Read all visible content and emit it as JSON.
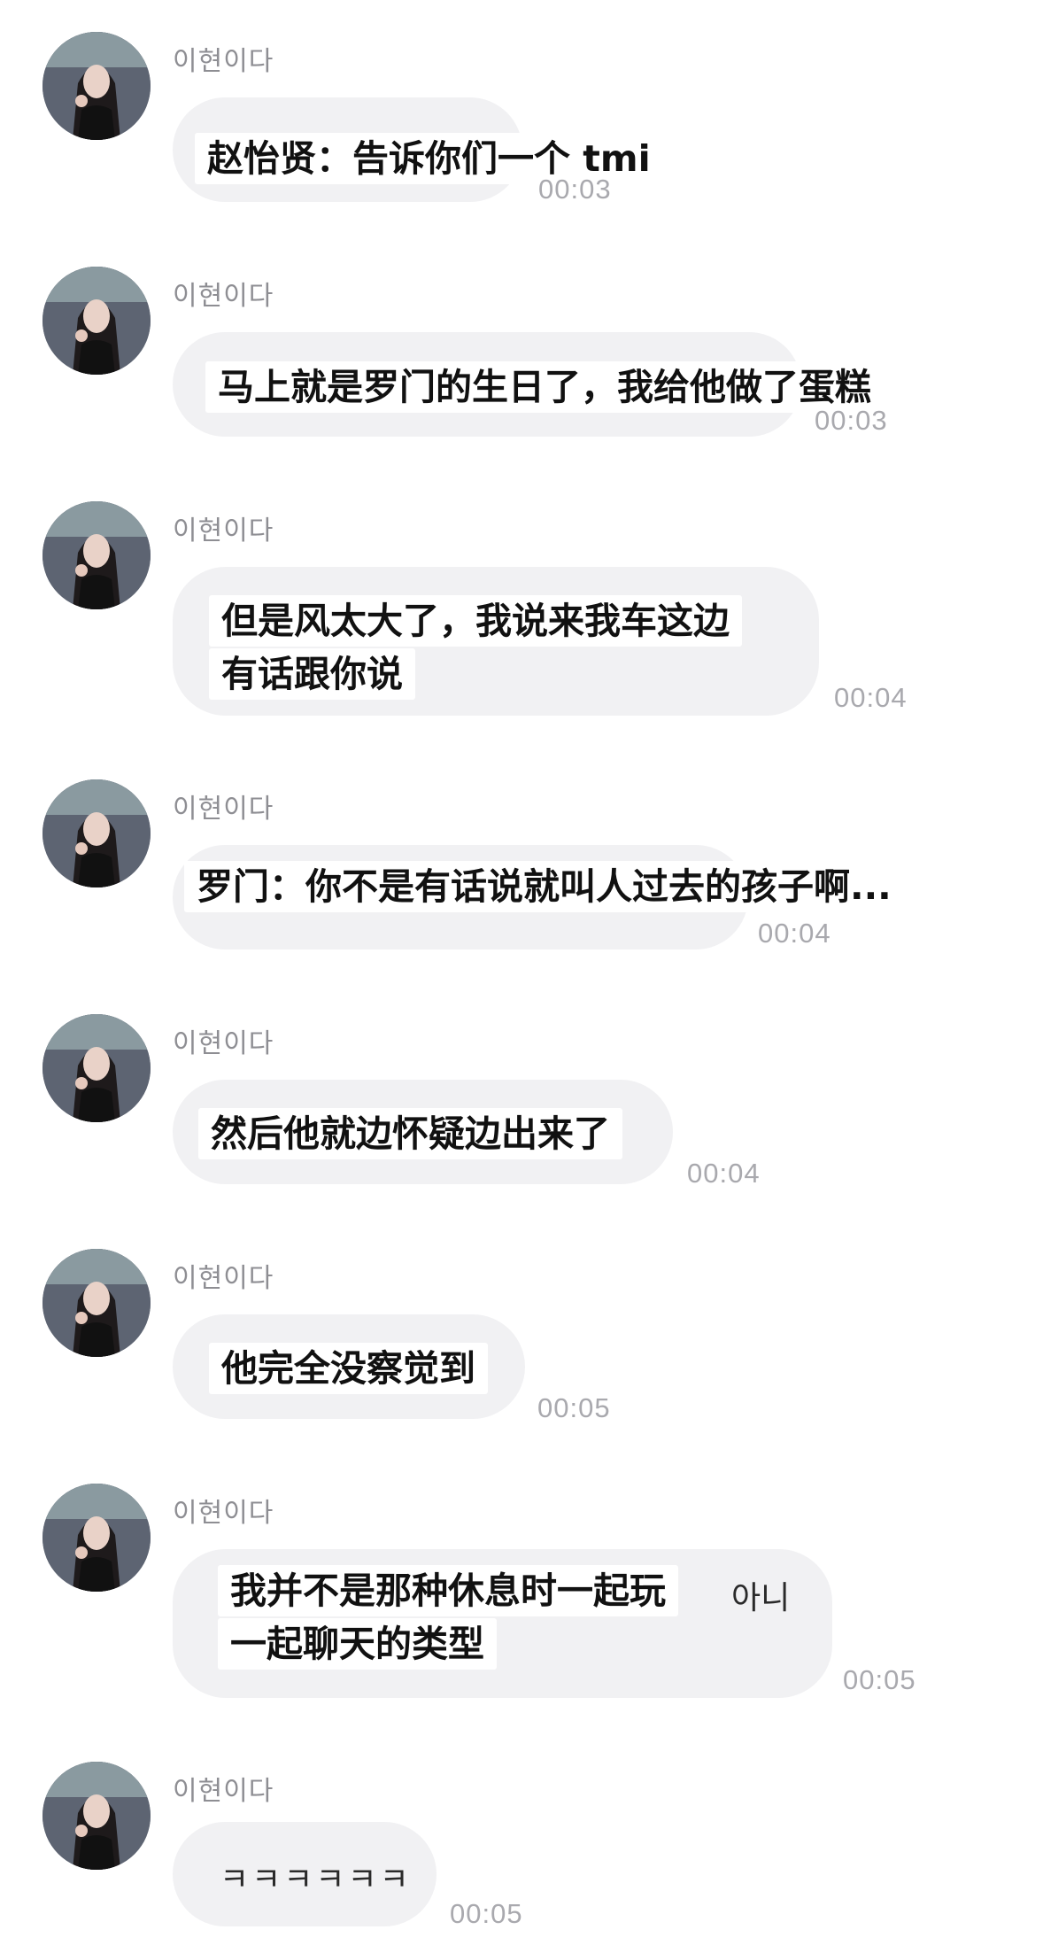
{
  "chat": {
    "messages": [
      {
        "sender": "이현이다",
        "caption_line1": "赵怡贤：告诉你们一个 tmi",
        "time": "00:03"
      },
      {
        "sender": "이현이다",
        "caption_line1": "马上就是罗门的生日了，我给他做了蛋糕",
        "time": "00:03"
      },
      {
        "sender": "이현이다",
        "caption_line1": "但是风太大了，我说来我车这边",
        "caption_line2": "有话跟你说",
        "time": "00:04"
      },
      {
        "sender": "이현이다",
        "caption_line1": "罗门：你不是有话说就叫人过去的孩子啊...",
        "time": "00:04"
      },
      {
        "sender": "이현이다",
        "caption_line1": "然后他就边怀疑边出来了",
        "time": "00:04"
      },
      {
        "sender": "이현이다",
        "caption_line1": "他完全没察觉到",
        "time": "00:05"
      },
      {
        "sender": "이현이다",
        "caption_line1": "我并不是那种休息时一起玩",
        "caption_line2": "一起聊天的类型",
        "raw_text": "아니",
        "time": "00:05"
      },
      {
        "sender": "이현이다",
        "raw_text": "ㅋㅋㅋㅋㅋㅋ",
        "time": "00:05"
      }
    ]
  },
  "colors": {
    "bubble": "#f1f1f3",
    "caption_bg": "#ffffff",
    "sender_text": "#8e8e93",
    "time_text": "#a9a9ae"
  },
  "icons": {
    "avatar": "profile-photo-avatar"
  }
}
